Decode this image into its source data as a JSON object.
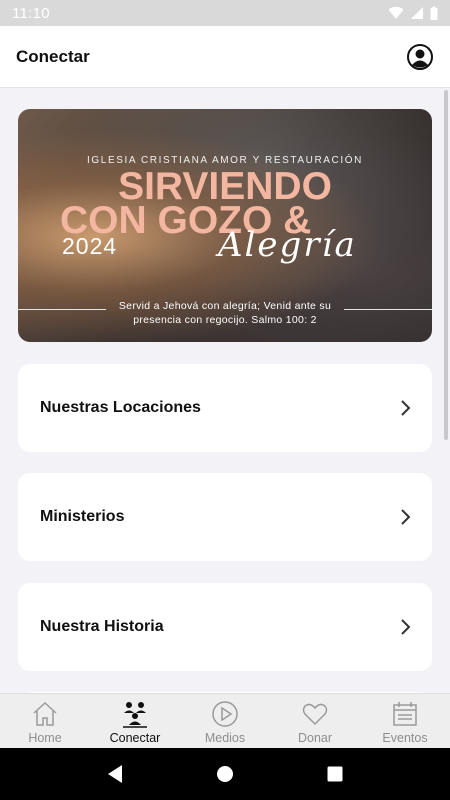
{
  "status_bar": {
    "time": "11:10"
  },
  "header": {
    "title": "Conectar"
  },
  "banner": {
    "church_name": "IGLESIA CRISTIANA AMOR Y RESTAURACIÓN",
    "headline_line1": "SIRVIENDO",
    "headline_line2": "CON GOZO &",
    "year": "2024",
    "script_word": "Alegría",
    "verse": "Servid a Jehová con alegría; Venid ante su presencia con regocijo. Salmo 100: 2"
  },
  "cards": [
    {
      "label": "Nuestras Locaciones"
    },
    {
      "label": "Ministerios"
    },
    {
      "label": "Nuestra Historia"
    }
  ],
  "tabs": [
    {
      "label": "Home",
      "icon": "home-icon"
    },
    {
      "label": "Conectar",
      "icon": "people-icon"
    },
    {
      "label": "Medios",
      "icon": "play-circle-icon"
    },
    {
      "label": "Donar",
      "icon": "heart-icon"
    },
    {
      "label": "Eventos",
      "icon": "calendar-icon"
    }
  ],
  "active_tab": "Conectar",
  "colors": {
    "accent": "#111111",
    "inactive": "#8e8e8e",
    "headline": "#f3b6a0"
  }
}
